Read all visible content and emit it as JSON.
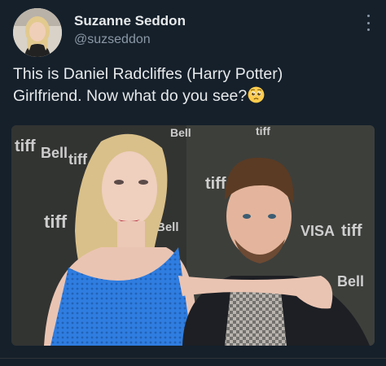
{
  "author": {
    "display_name": "Suzanne Seddon",
    "handle": "@suzseddon"
  },
  "tweet": {
    "line1": "This is Daniel Radcliffes (Harry Potter)",
    "line2": "Girlfriend. Now what do you see?",
    "emoji": "pleading-face-emoji"
  },
  "media": {
    "backdrop_logos": [
      "tiff",
      "Bell",
      "tiff",
      "Bell",
      "tiff",
      "tiff",
      "Bell",
      "tiff",
      "VISA",
      "tiff",
      "Bell"
    ]
  },
  "icons": {
    "more": "more-vertical-icon"
  },
  "colors": {
    "background": "#15202b",
    "text": "#e7e9ea",
    "secondary_text": "#8b98a5"
  }
}
